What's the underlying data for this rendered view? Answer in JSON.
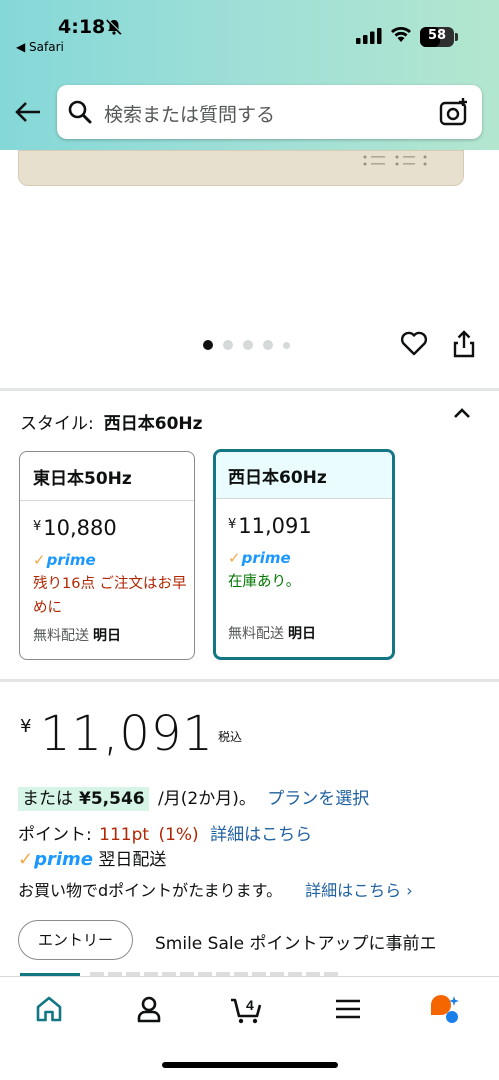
{
  "status_bar": {
    "time": "4:18",
    "back_app": "◀ Safari",
    "battery": "58",
    "battery_level": 0.58
  },
  "header": {
    "search_placeholder": "検索または質問する"
  },
  "carousel": {
    "count": 5,
    "active": 0
  },
  "style_selector": {
    "label": "スタイル:",
    "selected": "西日本60Hz",
    "options": [
      {
        "name": "東日本50Hz",
        "yen": "¥",
        "price": "10,880",
        "prime": "prime",
        "stock": "残り16点 ご注文はお早めに",
        "stock_color": "#b12704",
        "ship": "無料配送",
        "ship_day": "明日",
        "selected": false
      },
      {
        "name": "西日本60Hz",
        "yen": "¥",
        "price": "11,091",
        "prime": "prime",
        "stock": "在庫あり。",
        "stock_color": "#007600",
        "ship": "無料配送",
        "ship_day": "明日",
        "selected": true
      }
    ]
  },
  "price": {
    "yen": "¥",
    "amount": "11,091",
    "tax": "税込"
  },
  "installment": {
    "prefix": "または",
    "amount": "¥5,546",
    "suffix": "/月(2か月)。",
    "link": "プランを選択"
  },
  "points": {
    "label": "ポイント:",
    "value": "111pt",
    "percent": "(1%)",
    "link": "詳細はこちら"
  },
  "prime_delivery": {
    "badge": "prime",
    "text": "翌日配送"
  },
  "dpoint": {
    "text": "お買い物でdポイントがたまります。",
    "link": "詳細はこちら ›"
  },
  "promo": {
    "button": "エントリー",
    "text": "Smile Sale ポイントアップに事前エ"
  },
  "tabbar": {
    "cart_count": "4",
    "tabs": [
      "home-icon",
      "account-icon",
      "cart-icon",
      "menu-icon",
      "assistant-icon"
    ],
    "active_color": "#127782"
  }
}
